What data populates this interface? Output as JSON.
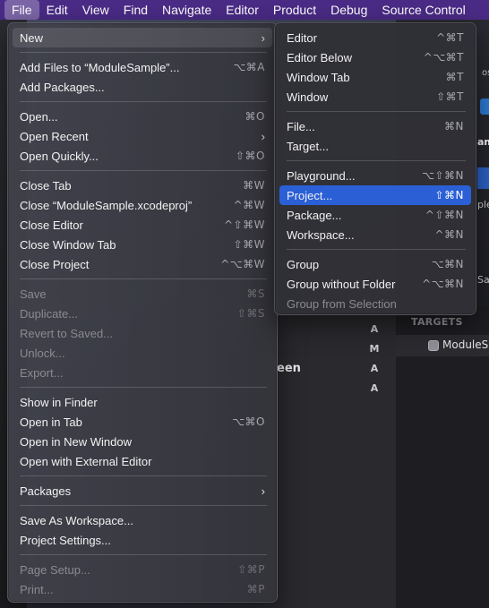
{
  "menubar": {
    "items": [
      "File",
      "Edit",
      "View",
      "Find",
      "Navigate",
      "Editor",
      "Product",
      "Debug",
      "Source Control"
    ]
  },
  "file_menu": {
    "items": [
      {
        "label": "New",
        "shortcut": "",
        "submenu": true
      },
      {
        "label": "Add Files to “ModuleSample”...",
        "shortcut": "⌥⌘A"
      },
      {
        "label": "Add Packages...",
        "shortcut": ""
      },
      {
        "label": "Open...",
        "shortcut": "⌘O"
      },
      {
        "label": "Open Recent",
        "shortcut": "",
        "submenu": true
      },
      {
        "label": "Open Quickly...",
        "shortcut": "⇧⌘O"
      },
      {
        "label": "Close Tab",
        "shortcut": "⌘W"
      },
      {
        "label": "Close “ModuleSample.xcodeproj”",
        "shortcut": "^⌘W"
      },
      {
        "label": "Close Editor",
        "shortcut": "^⇧⌘W"
      },
      {
        "label": "Close Window Tab",
        "shortcut": "⇧⌘W"
      },
      {
        "label": "Close Project",
        "shortcut": "^⌥⌘W"
      },
      {
        "label": "Save",
        "shortcut": "⌘S",
        "disabled": true
      },
      {
        "label": "Duplicate...",
        "shortcut": "⇧⌘S",
        "disabled": true
      },
      {
        "label": "Revert to Saved...",
        "shortcut": "",
        "disabled": true
      },
      {
        "label": "Unlock...",
        "shortcut": "",
        "disabled": true
      },
      {
        "label": "Export...",
        "shortcut": "",
        "disabled": true
      },
      {
        "label": "Show in Finder",
        "shortcut": ""
      },
      {
        "label": "Open in Tab",
        "shortcut": "⌥⌘O"
      },
      {
        "label": "Open in New Window",
        "shortcut": ""
      },
      {
        "label": "Open with External Editor",
        "shortcut": ""
      },
      {
        "label": "Packages",
        "shortcut": "",
        "submenu": true
      },
      {
        "label": "Save As Workspace...",
        "shortcut": ""
      },
      {
        "label": "Project Settings...",
        "shortcut": ""
      },
      {
        "label": "Page Setup...",
        "shortcut": "⇧⌘P",
        "disabled": true
      },
      {
        "label": "Print...",
        "shortcut": "⌘P",
        "disabled": true
      }
    ]
  },
  "new_submenu": {
    "items": [
      {
        "label": "Editor",
        "shortcut": "^⌘T"
      },
      {
        "label": "Editor Below",
        "shortcut": "^⌥⌘T"
      },
      {
        "label": "Window Tab",
        "shortcut": "⌘T"
      },
      {
        "label": "Window",
        "shortcut": "⇧⌘T"
      },
      {
        "label": "File...",
        "shortcut": "⌘N"
      },
      {
        "label": "Target...",
        "shortcut": ""
      },
      {
        "label": "Playground...",
        "shortcut": "⌥⇧⌘N"
      },
      {
        "label": "Project...",
        "shortcut": "⇧⌘N",
        "selected": true
      },
      {
        "label": "Package...",
        "shortcut": "^⇧⌘N"
      },
      {
        "label": "Workspace...",
        "shortcut": "^⌘N"
      },
      {
        "label": "Group",
        "shortcut": "⌥⌘N"
      },
      {
        "label": "Group without Folder",
        "shortcut": "^⌥⌘N"
      },
      {
        "label": "Group from Selection",
        "shortcut": "",
        "disabled": true
      }
    ]
  },
  "background": {
    "status_letters": [
      "A",
      "M",
      "A",
      "A"
    ],
    "partial_text": "een",
    "targets_header": "TARGETS",
    "target_name": "ModuleSa",
    "right_fragments": [
      "am",
      "ple",
      "Sa",
      "ost"
    ]
  },
  "colors": {
    "menubar": "#4a2b86",
    "selection": "#2a5fd6"
  }
}
